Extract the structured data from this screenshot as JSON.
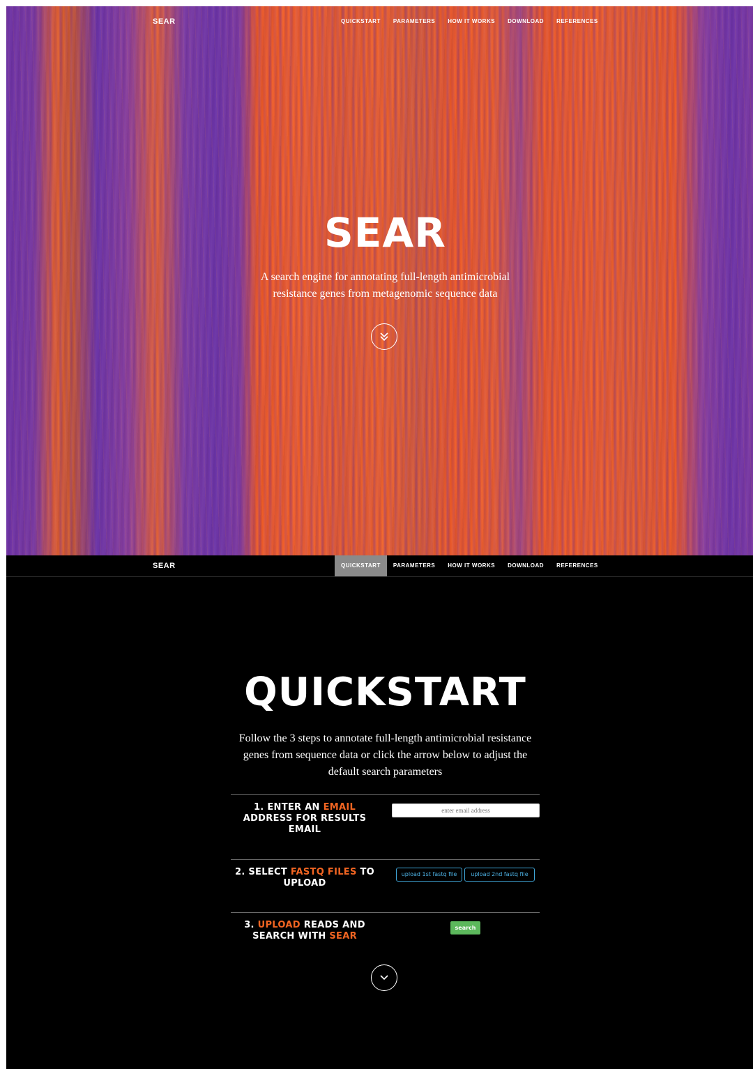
{
  "brand": "SEAR",
  "nav": {
    "items": [
      {
        "label": "QUICKSTART"
      },
      {
        "label": "PARAMETERS"
      },
      {
        "label": "HOW IT WORKS"
      },
      {
        "label": "DOWNLOAD"
      },
      {
        "label": "REFERENCES"
      }
    ],
    "active": "QUICKSTART"
  },
  "hero": {
    "title": "SEAR",
    "subtitle": "A search engine for annotating full-length antimicrobial resistance genes from metagenomic sequence data",
    "scroll_icon": "double-chevron-down-icon"
  },
  "quickstart": {
    "title": "QUICKSTART",
    "subtitle": "Follow the 3 steps to annotate full-length antimicrobial resistance genes from sequence data or click the arrow below to adjust the default search parameters",
    "step1": {
      "prefix": "1. ENTER AN ",
      "highlight": "EMAIL",
      "suffix": " ADDRESS FOR RESULTS EMAIL",
      "email_placeholder": "enter email address",
      "email_value": ""
    },
    "step2": {
      "prefix": "2. SELECT ",
      "highlight": "FASTQ FILES",
      "suffix": " TO UPLOAD",
      "upload1_label": "upload 1st fastq file",
      "upload2_label": "upload 2nd fastq file"
    },
    "step3": {
      "prefix": "3. ",
      "highlight": "UPLOAD",
      "middle": " READS AND SEARCH WITH ",
      "highlight2": "SEAR",
      "search_label": "search"
    },
    "scroll_icon": "chevron-down-icon"
  },
  "colors": {
    "accent": "#f26522",
    "upload_blue": "#4db3e6",
    "search_green": "#5cb85c",
    "nav_active": "#8a8a8a",
    "hero_orange": "#f05a22",
    "hero_purple": "#6d33a6"
  }
}
